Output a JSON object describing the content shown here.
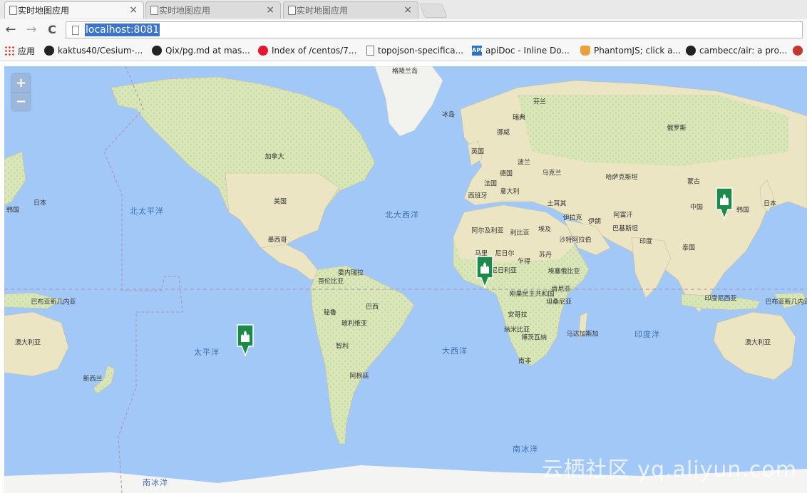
{
  "tabs": [
    {
      "title": "实时地图应用",
      "active": true
    },
    {
      "title": "实时地图应用",
      "active": false
    },
    {
      "title": "实时地图应用",
      "active": false
    }
  ],
  "toolbar": {
    "back": "←",
    "forward": "→",
    "reload": "C",
    "url": "localhost:8081"
  },
  "bookmarks": [
    {
      "label": "应用",
      "icon": "apps-grid-icon"
    },
    {
      "label": "kaktus40/Cesium-...",
      "icon": "github-icon"
    },
    {
      "label": "Qix/pg.md at mas...",
      "icon": "github-icon"
    },
    {
      "label": "Index of /centos/7...",
      "icon": "weibo-icon"
    },
    {
      "label": "topojson-specifica...",
      "icon": "document-icon"
    },
    {
      "label": "apiDoc - Inline Do...",
      "icon": "api-icon"
    },
    {
      "label": "PhantomJS; click a...",
      "icon": "phantom-icon"
    },
    {
      "label": "cambecc/air: a pro...",
      "icon": "github-icon"
    }
  ],
  "bookmark_api_badge": "API",
  "map": {
    "zoom_in": "+",
    "zoom_out": "−",
    "ocean_labels": [
      "北太平洋",
      "北大西洋",
      "太平洋",
      "大西洋",
      "印度洋",
      "南冰洋",
      "南冰洋"
    ],
    "place_labels": [
      "格陵兰岛",
      "芬兰",
      "冰岛",
      "瑞典",
      "挪威",
      "俄罗斯",
      "英国",
      "波兰",
      "德国",
      "乌克兰",
      "法国",
      "意大利",
      "西班牙",
      "哈萨克斯坦",
      "蒙古",
      "中国",
      "日本",
      "韩国",
      "日本",
      "韩国",
      "土耳其",
      "伊拉克",
      "伊朗",
      "阿富汗",
      "巴基斯坦",
      "印度",
      "泰国",
      "阿尔及利亚",
      "利比亚",
      "埃及",
      "沙特阿拉伯",
      "马里",
      "尼日尔",
      "苏丹",
      "尼日利亚",
      "乍得",
      "埃塞俄比亚",
      "刚果民主共和国",
      "肯尼亚",
      "坦桑尼亚",
      "安哥拉",
      "纳米比亚",
      "博茨瓦纳",
      "南非",
      "马达加斯加",
      "加拿大",
      "美国",
      "墨西哥",
      "委内瑞拉",
      "哥伦比亚",
      "秘鲁",
      "巴西",
      "玻利维亚",
      "智利",
      "阿根廷",
      "巴布亚新几内亚",
      "巴布亚新几内亚",
      "印度尼西亚",
      "澳大利亚",
      "澳大利亚",
      "新西兰"
    ],
    "markers": [
      {
        "name": "marker-pacific",
        "icon": "castle-icon"
      },
      {
        "name": "marker-africa",
        "icon": "castle-icon"
      },
      {
        "name": "marker-china",
        "icon": "castle-icon"
      }
    ],
    "marker_color": "#1e8a4a",
    "land_color": "#ece5c4",
    "forest_color": "#cfe2b0",
    "water_color": "#a2c8f8"
  },
  "watermark": "云栖社区 yq.aliyun.com"
}
